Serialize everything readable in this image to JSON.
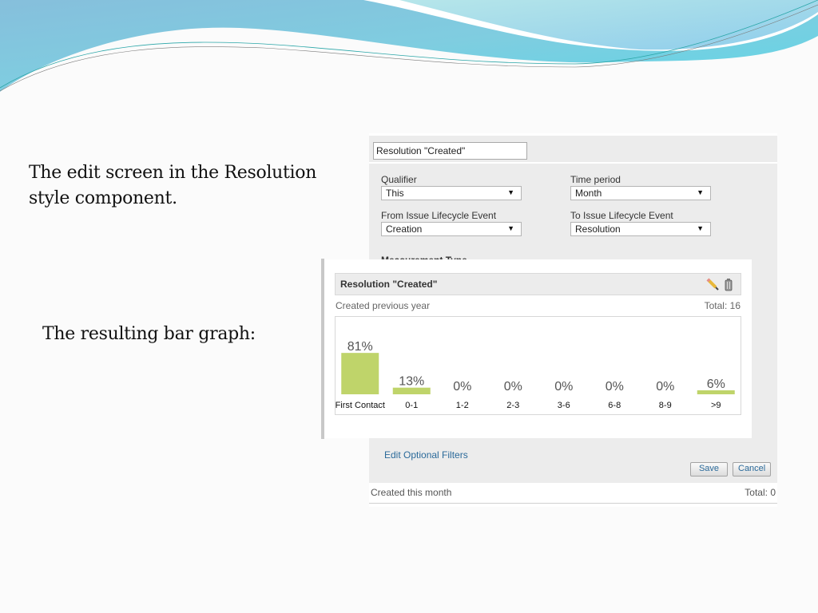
{
  "slide": {
    "caption_edit": "The edit screen in the Resolution style component.",
    "caption_graph": "The resulting bar graph:"
  },
  "edit_screen": {
    "title_value": "Resolution \"Created\"",
    "fields": {
      "qualifier": {
        "label": "Qualifier",
        "value": "This"
      },
      "time_period": {
        "label": "Time period",
        "value": "Month"
      },
      "from_event": {
        "label": "From Issue Lifecycle Event",
        "value": "Creation"
      },
      "to_event": {
        "label": "To Issue Lifecycle Event",
        "value": "Resolution"
      },
      "measurement_type": {
        "label": "Measurement Type"
      }
    },
    "edit_filters_link": "Edit Optional Filters",
    "save_label": "Save",
    "cancel_label": "Cancel",
    "footer": {
      "label": "Created this month",
      "total": "Total:  0"
    }
  },
  "graph_panel": {
    "title": "Resolution \"Created\"",
    "subtitle": "Created previous year",
    "total": "Total:  16",
    "icons": {
      "edit": "pencil-icon",
      "delete": "trash-icon"
    }
  },
  "chart_data": {
    "type": "bar",
    "title": "Resolution \"Created\"",
    "xlabel": "",
    "ylabel": "",
    "categories": [
      "First Contact",
      "0-1",
      "1-2",
      "2-3",
      "3-6",
      "6-8",
      "8-9",
      ">9"
    ],
    "values": [
      81,
      13,
      0,
      0,
      0,
      0,
      0,
      6
    ],
    "value_labels": [
      "81%",
      "13%",
      "0%",
      "0%",
      "0%",
      "0%",
      "0%",
      "6%"
    ],
    "unit": "%",
    "ylim": [
      0,
      100
    ],
    "grid": false,
    "bar_color": "#bfd46a"
  },
  "colors": {
    "link": "#2b6a9a",
    "panel_bg": "#ececec",
    "bar": "#bfd46a"
  }
}
